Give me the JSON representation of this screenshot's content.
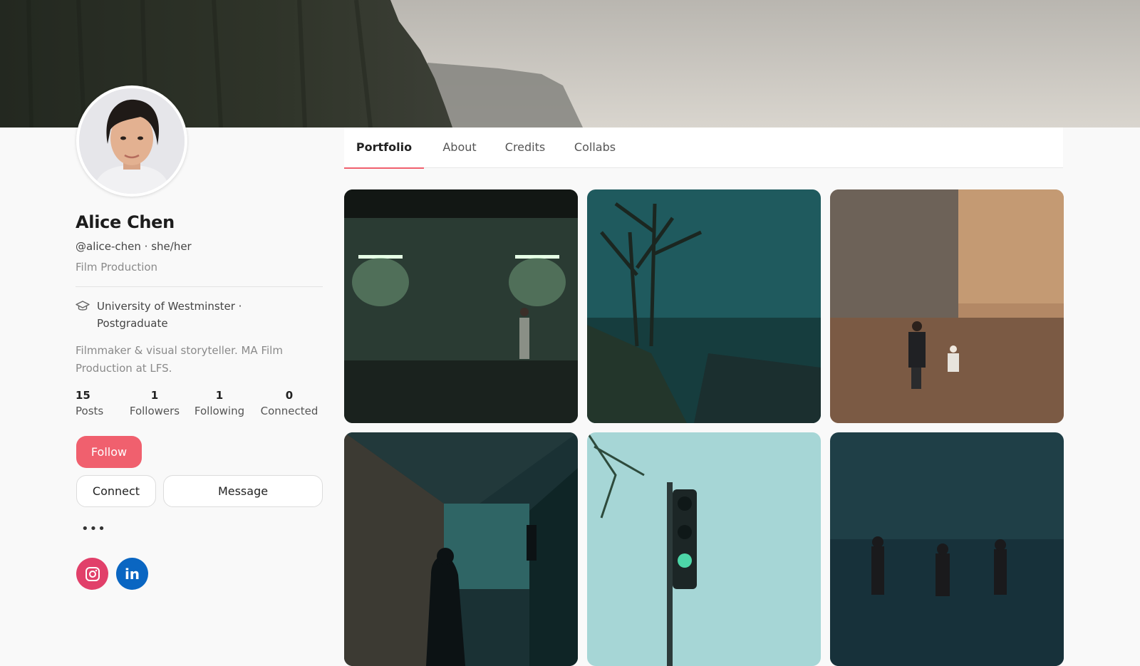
{
  "profile": {
    "name": "Alice Chen",
    "handle_line": "@alice-chen · she/her",
    "role": "Film Production",
    "education": "University of Westminster · Postgraduate",
    "bio": "Filmmaker & visual storyteller. MA Film Production at LFS.",
    "stats": [
      {
        "value": "15",
        "label": "Posts"
      },
      {
        "value": "1",
        "label": "Followers"
      },
      {
        "value": "1",
        "label": "Following"
      },
      {
        "value": "0",
        "label": "Connected"
      }
    ]
  },
  "actions": {
    "follow": "Follow",
    "connect": "Connect",
    "message": "Message",
    "more": "•••"
  },
  "social": [
    {
      "name": "instagram-icon",
      "color": "#e1306c"
    },
    {
      "name": "linkedin-icon",
      "color": "#0a66c2",
      "glyph": "in"
    }
  ],
  "tabs": [
    {
      "label": "Portfolio",
      "active": true
    },
    {
      "label": "About",
      "active": false
    },
    {
      "label": "Credits",
      "active": false
    },
    {
      "label": "Collabs",
      "active": false
    }
  ],
  "colors": {
    "accent": "#f0606e",
    "background": "#f9f9f9"
  },
  "portfolio": [
    {
      "name": "tile-underpass-figure"
    },
    {
      "name": "tile-foggy-trees-road"
    },
    {
      "name": "tile-autumn-hikers"
    },
    {
      "name": "tile-tunnel-silhouettes"
    },
    {
      "name": "tile-traffic-light-fog"
    },
    {
      "name": "tile-beach-night-figures"
    }
  ]
}
